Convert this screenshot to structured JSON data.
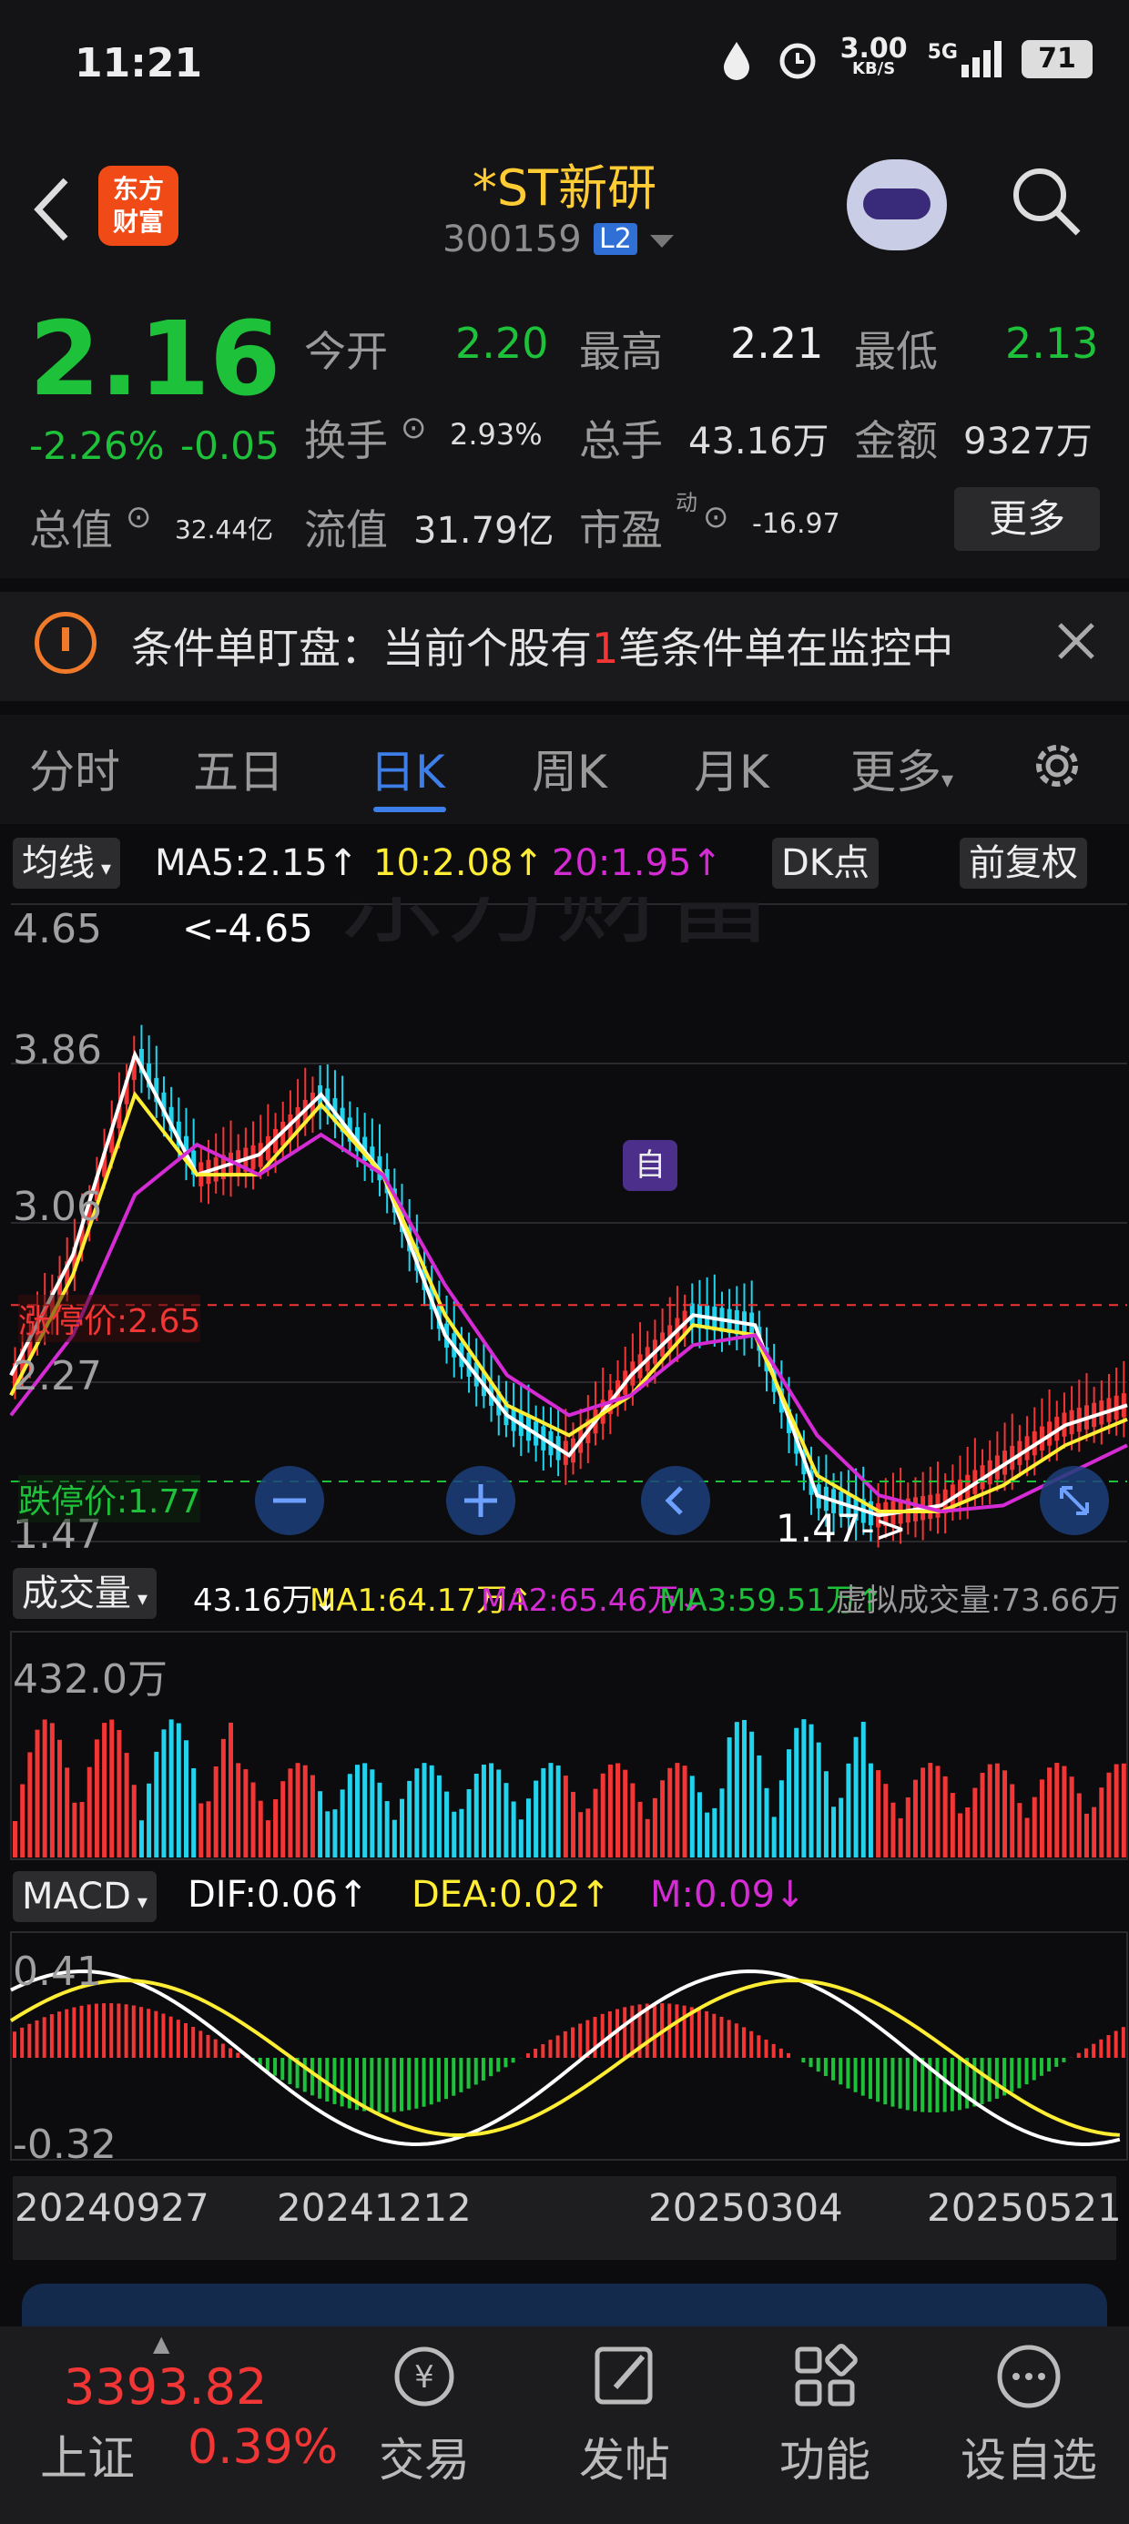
{
  "status": {
    "time": "11:21",
    "net_speed": "3.00",
    "net_unit": "KB/S",
    "signal": "5G",
    "battery": "71"
  },
  "header": {
    "back_icon": "back-arrow-icon",
    "logo_line1": "东方",
    "logo_line2": "财富",
    "title": "*ST新研",
    "code": "300159",
    "badge": "L2"
  },
  "quote": {
    "price": "2.16",
    "change_pct": "-2.26%",
    "change": "-0.05",
    "open_label": "今开",
    "open": "2.20",
    "high_label": "最高",
    "high": "2.21",
    "low_label": "最低",
    "low": "2.13",
    "turnover_label": "换手",
    "turnover": "2.93%",
    "volume_label": "总手",
    "volume": "43.16万",
    "amount_label": "金额",
    "amount": "9327万",
    "mktcap_label": "总值",
    "mktcap": "32.44亿",
    "float_label": "流值",
    "float_cap": "31.79亿",
    "pe_label": "市盈",
    "pe_sup": "动",
    "pe": "-16.97",
    "more": "更多"
  },
  "notice": {
    "prefix": "条件单盯盘：当前个股有",
    "count": "1",
    "suffix": "笔条件单在监控中"
  },
  "tabs": [
    "分时",
    "五日",
    "日K",
    "周K",
    "月K",
    "更多"
  ],
  "kline": {
    "selector": "均线",
    "ma5": "MA5:2.15↑",
    "ma10": "10:2.08↑",
    "ma20": "20:1.95↑",
    "dk": "DK点",
    "adjust": "前复权",
    "y_high": "4.65",
    "y_mid1": "3.86",
    "y_mid2": "3.06",
    "y_mid3": "2.27",
    "y_low": "1.47",
    "max_marker": "<-4.65",
    "min_marker": "1.47->",
    "limit_up": "涨停价:2.65",
    "limit_down": "跌停价:1.77",
    "tag_self": "自"
  },
  "volume": {
    "selector": "成交量",
    "vol": "43.16万↓",
    "ma1": "MA1:64.17万↑",
    "ma2": "MA2:65.46万↓",
    "ma3": "MA3:59.51万↑",
    "virtual": "虚拟成交量:73.66万",
    "y_max": "432.0万"
  },
  "macd": {
    "selector": "MACD",
    "dif": "DIF:0.06↑",
    "dea": "DEA:0.02↑",
    "m": "M:0.09↓",
    "y_top": "0.41",
    "y_bottom": "-0.32"
  },
  "dates": [
    "20240927",
    "20241212",
    "20250304",
    "20250521"
  ],
  "bottom": {
    "index_value": "3393.82",
    "index_name": "上证",
    "index_pct": "0.39%",
    "nav": [
      "交易",
      "发帖",
      "功能",
      "设自选"
    ]
  },
  "colors": {
    "up": "#f23535",
    "down": "#1ec23a",
    "accent": "#3d7ee8",
    "ma5": "#ffffff",
    "ma10": "#ffee33",
    "ma20": "#d52bd5"
  },
  "chart_data": {
    "type": "line",
    "title": "*ST新研 日K",
    "ylim": [
      1.47,
      4.65
    ],
    "series": [
      {
        "name": "MA5",
        "values": [
          2.3,
          2.9,
          3.9,
          3.3,
          3.4,
          3.7,
          3.3,
          2.5,
          2.1,
          1.9,
          2.3,
          2.6,
          2.55,
          1.7,
          1.6,
          1.65,
          1.85,
          2.05,
          2.15
        ]
      },
      {
        "name": "MA10",
        "values": [
          2.2,
          2.8,
          3.7,
          3.3,
          3.3,
          3.65,
          3.3,
          2.6,
          2.15,
          2.0,
          2.2,
          2.55,
          2.5,
          1.8,
          1.62,
          1.62,
          1.75,
          1.95,
          2.08
        ]
      },
      {
        "name": "MA20",
        "values": [
          2.1,
          2.5,
          3.2,
          3.45,
          3.3,
          3.5,
          3.3,
          2.75,
          2.3,
          2.1,
          2.2,
          2.45,
          2.5,
          2.0,
          1.7,
          1.62,
          1.65,
          1.8,
          1.95
        ]
      }
    ]
  }
}
